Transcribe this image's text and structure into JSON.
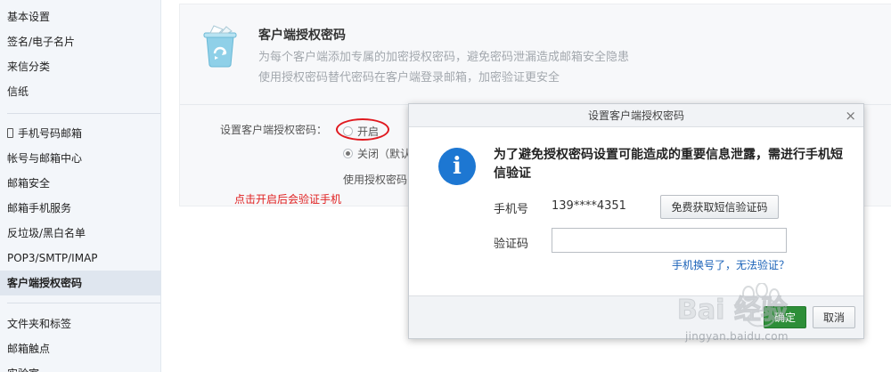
{
  "sidebar": {
    "group1": [
      "基本设置",
      "签名/电子名片",
      "来信分类",
      "信纸"
    ],
    "group2": [
      "手机号码邮箱",
      "帐号与邮箱中心",
      "邮箱安全",
      "邮箱手机服务",
      "反垃圾/黑白名单",
      "POP3/SMTP/IMAP",
      "客户端授权密码"
    ],
    "group3": [
      "文件夹和标签",
      "邮箱触点",
      "实验室"
    ],
    "active_item": "客户端授权密码"
  },
  "panel": {
    "title": "客户端授权密码",
    "desc1": "为每个客户端添加专属的加密授权密码，避免密码泄漏造成邮箱安全隐患",
    "desc2": "使用授权密码替代密码在客户端登录邮箱，加密验证更安全",
    "field_label": "设置客户端授权密码：",
    "radio_on": "开启",
    "radio_off": "关闭（默认",
    "usage_text": "使用授权密码",
    "selected": "关闭",
    "hint": "点击开启后会验证手机"
  },
  "dialog": {
    "title": "设置客户端授权密码",
    "close": "×",
    "message": "为了避免授权密码设置可能造成的重要信息泄露，需进行手机短信验证",
    "phone_label": "手机号",
    "phone_value": "139****4351",
    "sms_button": "免费获取短信验证码",
    "code_label": "验证码",
    "code_value": "",
    "code_placeholder": "",
    "link": "手机换号了，无法验证？",
    "ok_button": "确定",
    "cancel_button": "取消"
  },
  "watermark": {
    "brand": "Bai  经验",
    "url": "jingyan.baidu.com"
  },
  "colors": {
    "accent_blue": "#1d77d2",
    "link_blue": "#1a62b8",
    "hint_red": "#e02020",
    "ok_green": "#2d8e38"
  },
  "icons": [
    "recycle-bin-icon",
    "phone-icon",
    "info-icon",
    "close-icon",
    "baidu-paw-icon"
  ]
}
